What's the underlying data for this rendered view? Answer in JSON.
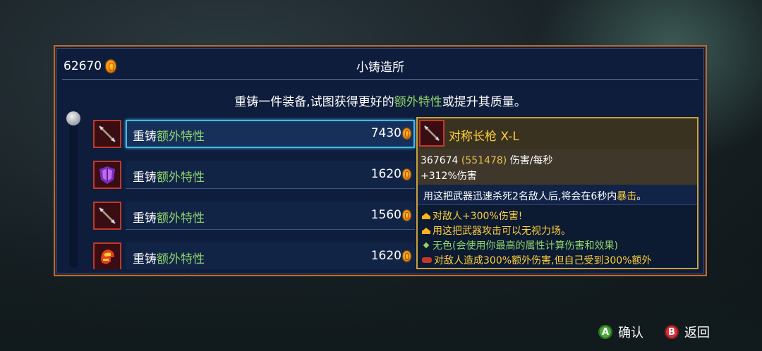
{
  "header": {
    "gold": "62670",
    "title": "小铸造所"
  },
  "description": {
    "prefix": "重铸一件装备,试图获得更好的",
    "highlight": "额外特性",
    "suffix": "或提升其质量。"
  },
  "list": [
    {
      "label_prefix": "重铸",
      "label_highlight": "额外特性",
      "cost": "7430",
      "icon": "spear-icon",
      "selected": true
    },
    {
      "label_prefix": "重铸",
      "label_highlight": "额外特性",
      "cost": "1620",
      "icon": "shield-icon",
      "selected": false
    },
    {
      "label_prefix": "重铸",
      "label_highlight": "额外特性",
      "cost": "1560",
      "icon": "spear-icon",
      "selected": false
    },
    {
      "label_prefix": "重铸",
      "label_highlight": "额外特性",
      "cost": "1620",
      "icon": "helmet-icon",
      "selected": false
    }
  ],
  "tooltip": {
    "name": "对称长枪  X-L",
    "dps": "367674",
    "dps_max": "(551478)",
    "dps_unit": "伤害/每秒",
    "damage_bonus": "+312%伤害",
    "effect_prefix": "用这把武器迅速杀死2名敌人后,将会在6秒内",
    "effect_highlight": "暴击",
    "effect_suffix": "。",
    "affixes": [
      {
        "type": "crown",
        "text": "对敌人+300%伤害!",
        "color": "#ffcf3a"
      },
      {
        "type": "crown",
        "text": "用这把武器攻击可以无视力场。",
        "color": "#ffcf3a"
      },
      {
        "type": "dot",
        "text": "无色(会使用你最高的属性计算伤害和效果)",
        "color": "#8fd46a"
      },
      {
        "type": "curse",
        "text": "对敌人造成300%额外伤害,但自己受到300%额外",
        "color": "#ffcf3a"
      }
    ]
  },
  "footer": {
    "confirm_key": "A",
    "confirm_label": "确认",
    "back_key": "B",
    "back_label": "返回"
  }
}
